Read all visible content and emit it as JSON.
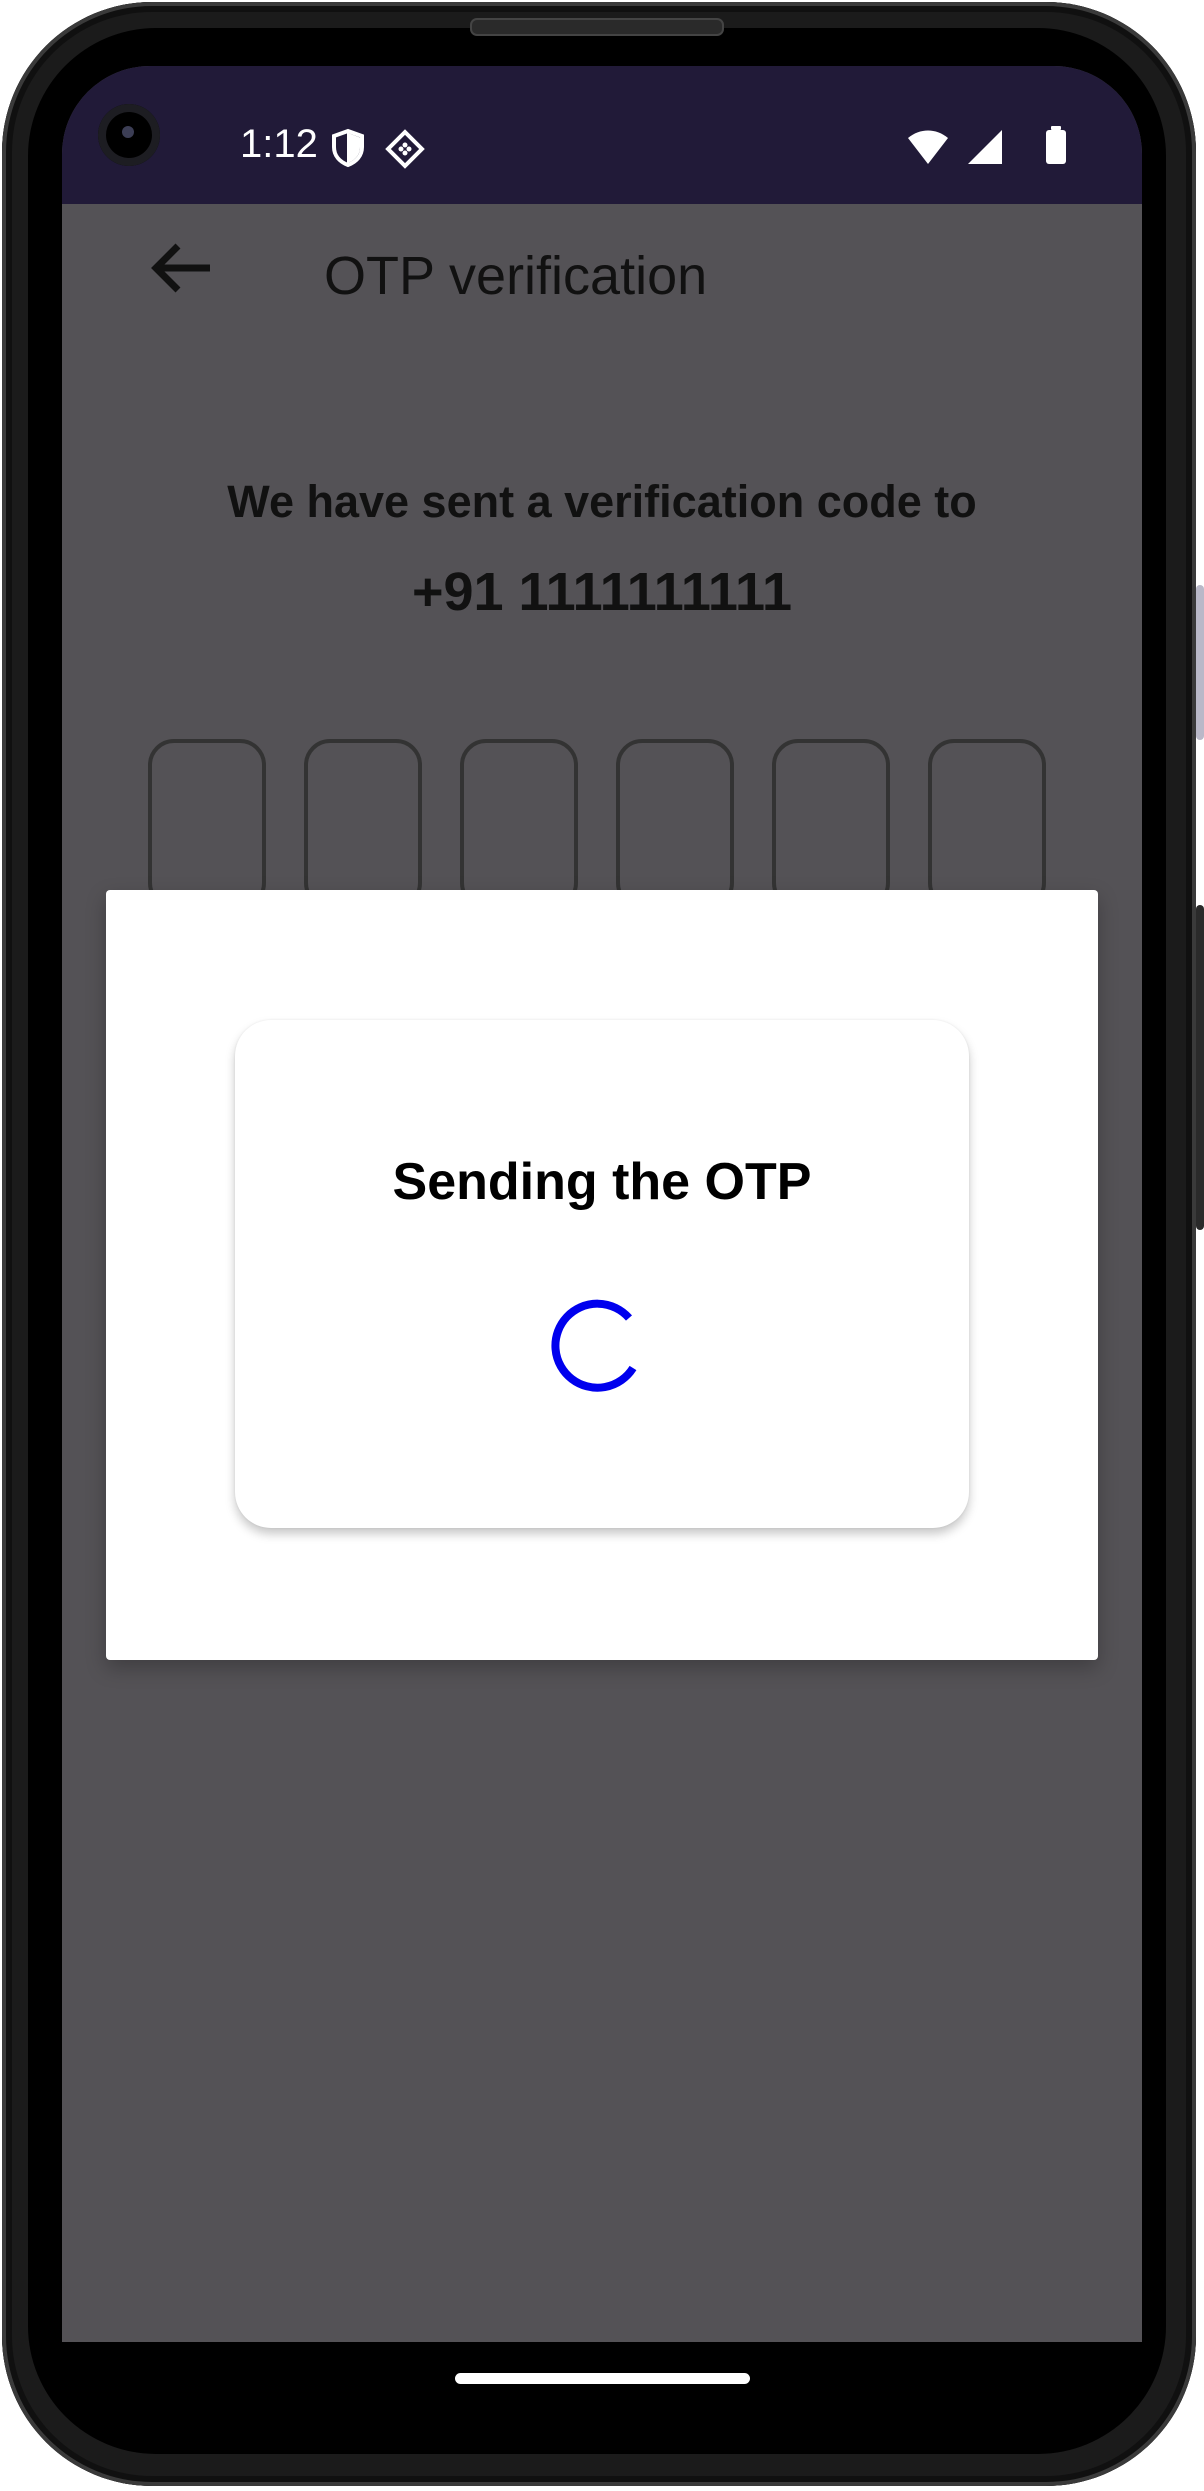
{
  "status_bar": {
    "time": "1:12",
    "left_icons": [
      "shield-icon",
      "security-app-icon"
    ],
    "right_icons": [
      "wifi-icon",
      "cell-signal-icon",
      "battery-icon"
    ],
    "background": "#211a38"
  },
  "header": {
    "back_icon": "arrow-left-icon",
    "title": "OTP verification"
  },
  "verification": {
    "message": "We have sent a verification code to",
    "phone": "+91 1111111111"
  },
  "otp": {
    "digits": [
      "",
      "",
      "",
      "",
      "",
      ""
    ]
  },
  "dialog": {
    "title": "Sending the OTP",
    "spinner_icon": "loading-spinner-icon",
    "spinner_color": "#0000ee"
  },
  "colors": {
    "scrim": "#545256",
    "text": "#111111",
    "dialog_bg": "#ffffff"
  }
}
